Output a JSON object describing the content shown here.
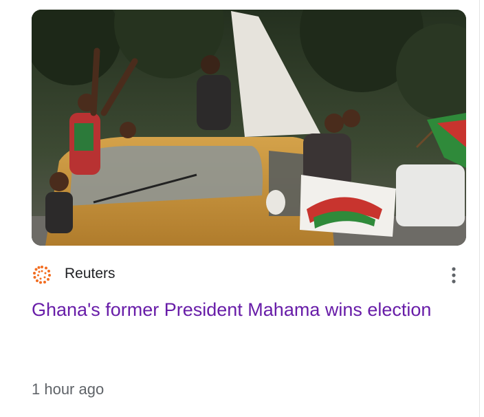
{
  "article": {
    "image_alt": "NDC supporters celebrating on a taxi with a party flag",
    "source": {
      "name": "Reuters",
      "logo_icon": "reuters-logo-icon",
      "logo_color": "#f26d21"
    },
    "more_icon": "more-vert-icon",
    "headline": "Ghana's former President Mahama wins election",
    "timestamp": "1 hour ago",
    "headline_color": "#681da8"
  }
}
